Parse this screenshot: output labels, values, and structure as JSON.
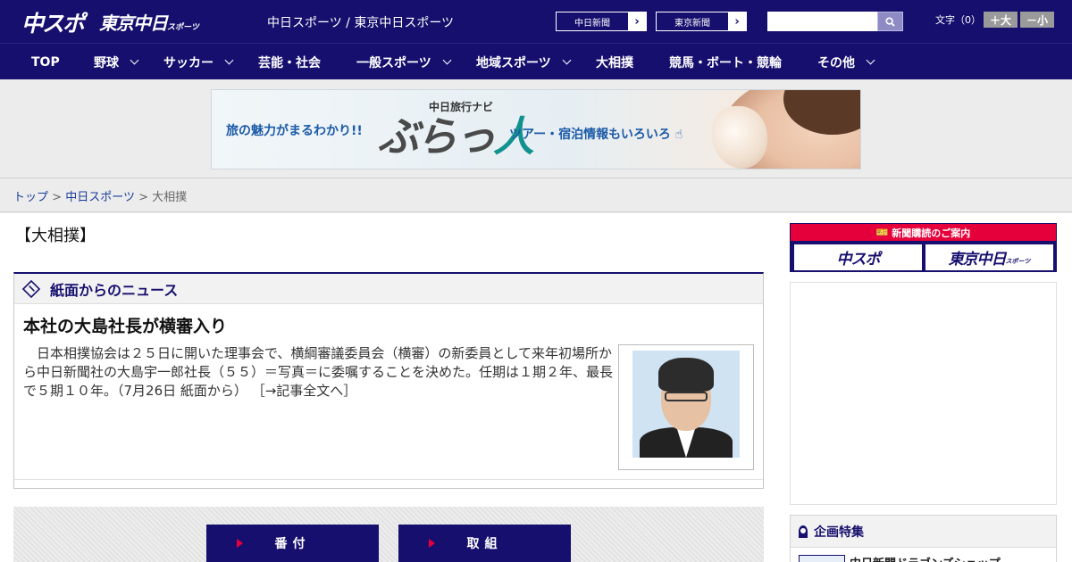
{
  "header": {
    "logo_chuspo": "中スポ",
    "logo_tokyo": "東京中日",
    "logo_tokyo_small": "スポーツ",
    "site_names": "中日スポーツ / 東京中日スポーツ",
    "paper_links": [
      "中日新聞",
      "東京新聞"
    ],
    "search": {
      "value": "",
      "placeholder": "",
      "icon": "search-icon"
    },
    "font_size_label": "文字（0）",
    "font_plus": "＋大",
    "font_minus": "－小"
  },
  "nav": {
    "items": [
      {
        "label": "TOP",
        "dropdown": false
      },
      {
        "label": "野球",
        "dropdown": true
      },
      {
        "label": "サッカー",
        "dropdown": true
      },
      {
        "label": "芸能・社会",
        "dropdown": false
      },
      {
        "label": "一般スポーツ",
        "dropdown": true
      },
      {
        "label": "地域スポーツ",
        "dropdown": true
      },
      {
        "label": "大相撲",
        "dropdown": false
      },
      {
        "label": "競馬・ボート・競輪",
        "dropdown": false
      },
      {
        "label": "その他",
        "dropdown": true
      }
    ]
  },
  "ad": {
    "tagline_left": "旅の魅力がまるわかり!!",
    "brand_small": "中日旅行ナビ",
    "brand_main_a": "ぶらっ",
    "brand_main_b": "人",
    "tagline_right": "ツアー・宿泊情報もいろいろ"
  },
  "breadcrumb": {
    "items": [
      "トップ",
      "中日スポーツ",
      "大相撲"
    ],
    "separator": ">"
  },
  "main": {
    "category_title": "【大相撲】",
    "section_title": "紙面からのニュース",
    "headline": "本社の大島社長が横審入り",
    "body": "　日本相撲協会は２５日に開いた理事会で、横綱審議委員会（横審）の新委員として来年初場所から中日新聞社の大島宇一郎社長（５５）＝写真＝に委嘱することを決めた。任期は１期２年、最長で５期１０年。（7月26日 紙面から）",
    "more_link": "［→記事全文へ］",
    "buttons": [
      "番付",
      "取組"
    ]
  },
  "sidebar": {
    "subscribe_head": "新聞購読のご案内",
    "subscribe_logos": [
      "中スポ",
      "東京中日"
    ],
    "subscribe_logo_small": "スポーツ",
    "feature_title": "企画特集",
    "feature_link": "中日新聞ドラゴンズショップ"
  },
  "colors": {
    "brand_navy": "#160f6e",
    "accent_red": "#e5003b",
    "link_blue": "#1a3d99"
  }
}
